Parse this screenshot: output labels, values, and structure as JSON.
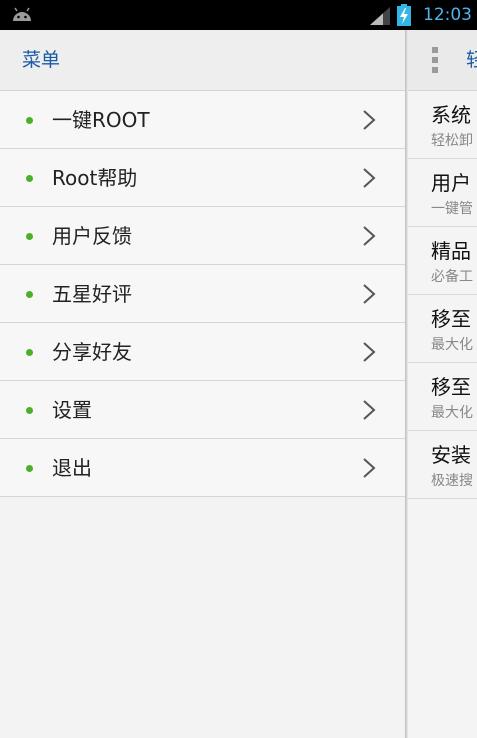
{
  "status_bar": {
    "time": "12:03",
    "time_color": "#4fb4ea"
  },
  "drawer": {
    "title": "菜单",
    "items": [
      {
        "label": "一键ROOT"
      },
      {
        "label": "Root帮助"
      },
      {
        "label": "用户反馈"
      },
      {
        "label": "五星好评"
      },
      {
        "label": "分享好友"
      },
      {
        "label": "设置"
      },
      {
        "label": "退出"
      }
    ],
    "accent": "#1a5aa6",
    "dot_color": "#4caf2a"
  },
  "main": {
    "title": "轻",
    "items": [
      {
        "title": "系统",
        "subtitle": "轻松卸"
      },
      {
        "title": "用户",
        "subtitle": "一键管"
      },
      {
        "title": "精品",
        "subtitle": "必备工"
      },
      {
        "title": "移至",
        "subtitle": "最大化"
      },
      {
        "title": "移至",
        "subtitle": "最大化"
      },
      {
        "title": "安装",
        "subtitle": "极速搜"
      }
    ]
  }
}
